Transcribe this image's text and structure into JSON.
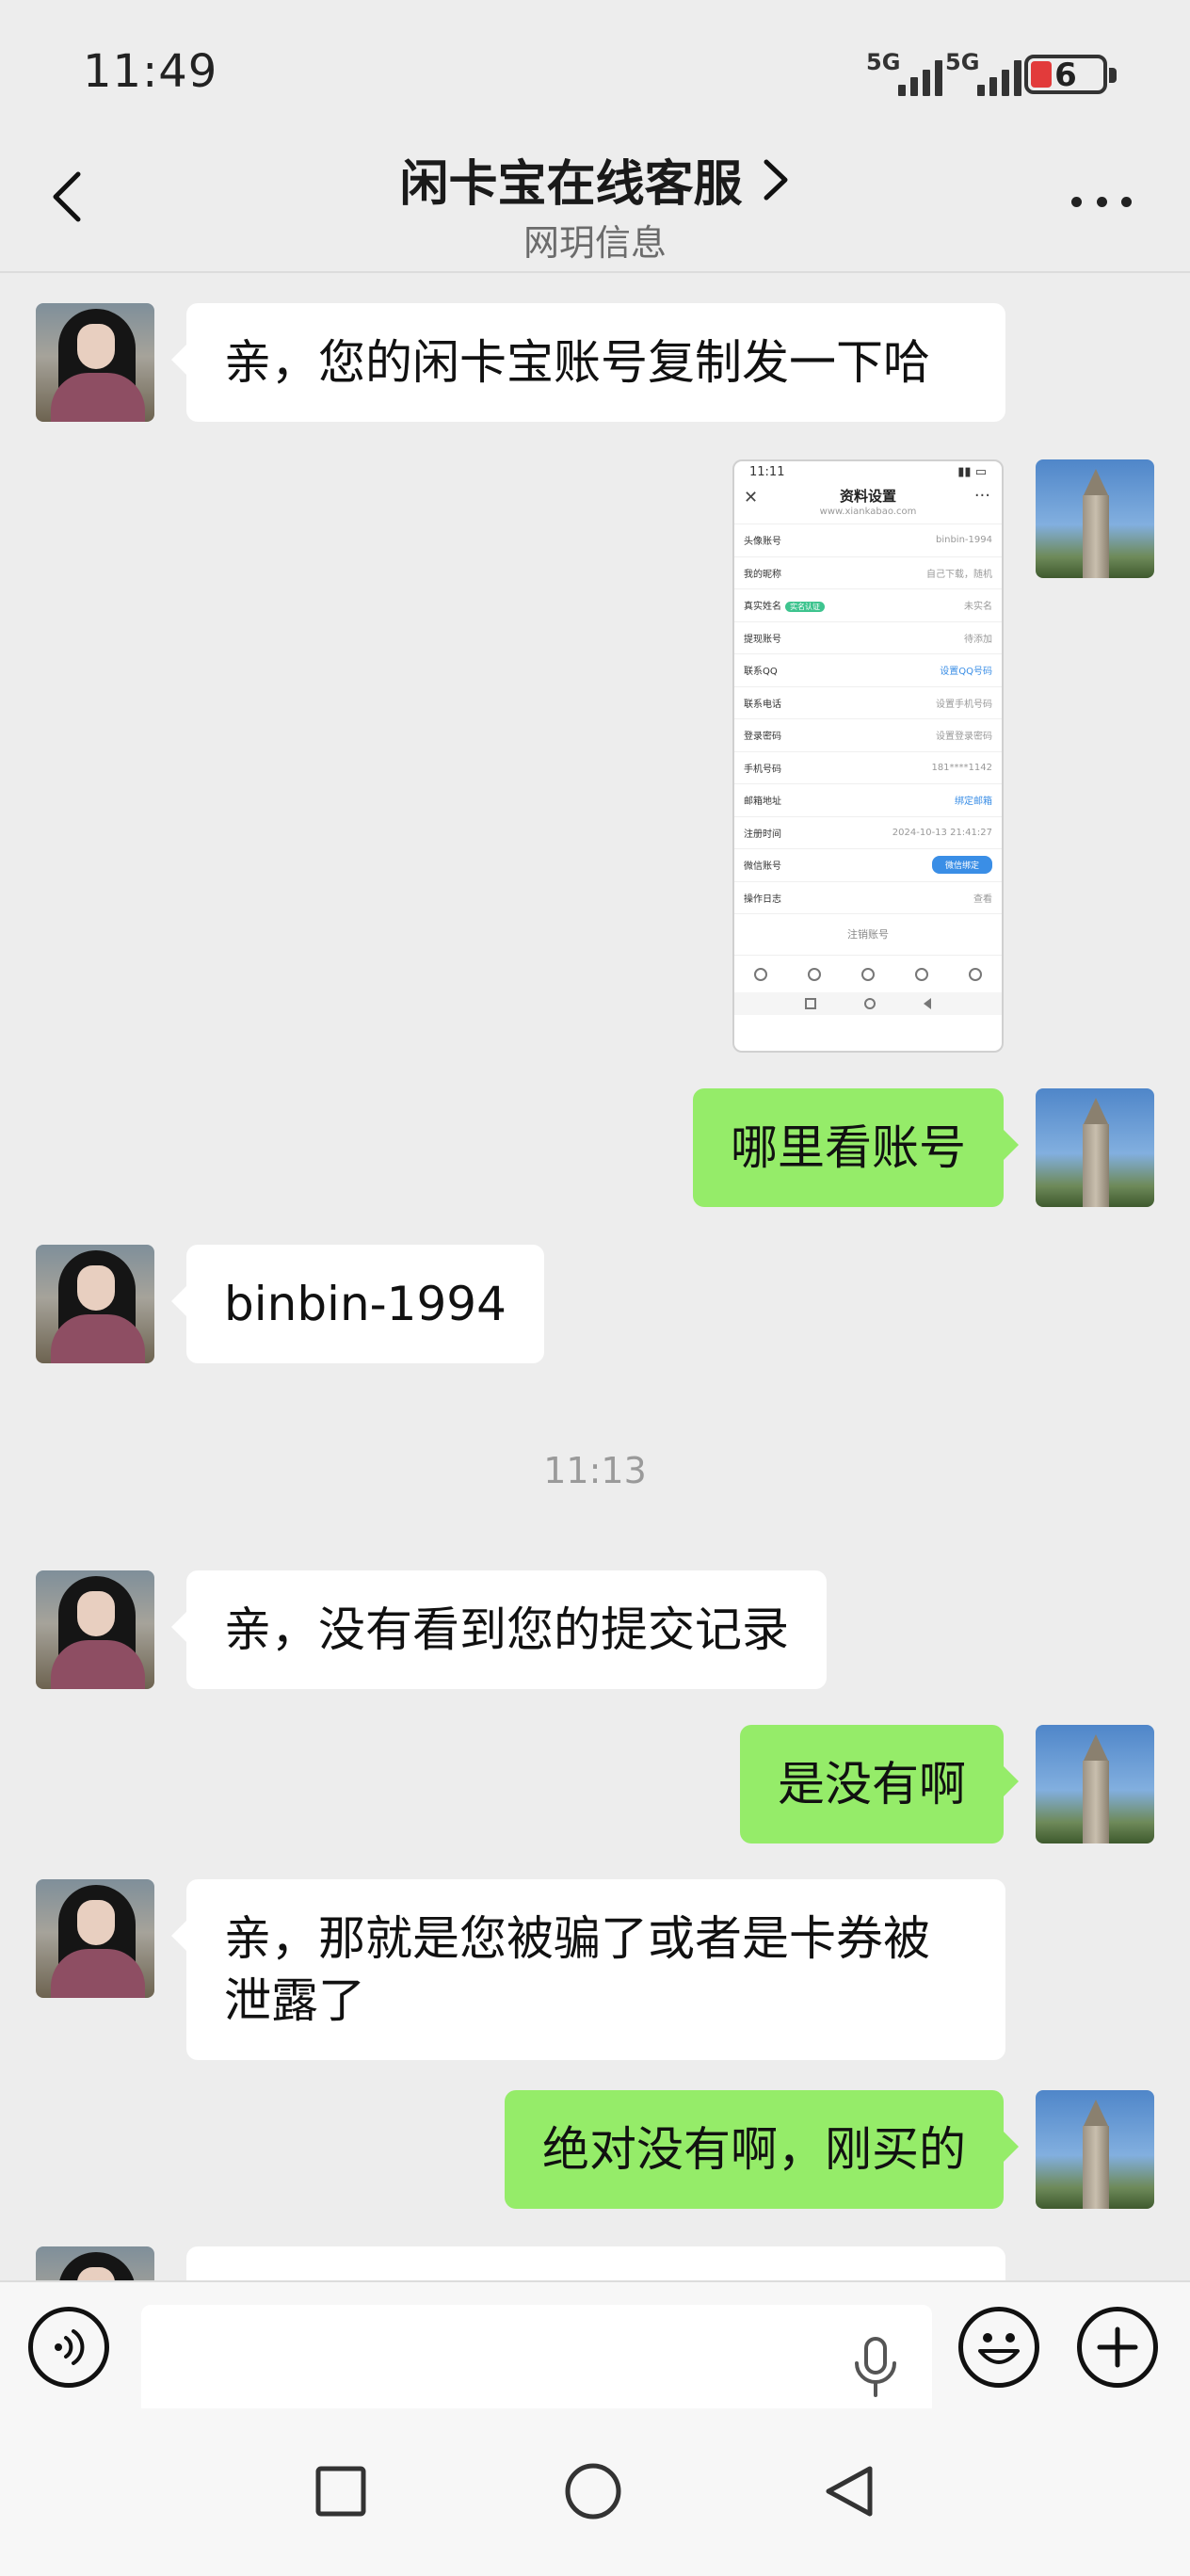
{
  "status_bar": {
    "time": "11:49",
    "signal_1_label": "5G",
    "signal_2_label": "5G",
    "battery_level": "6",
    "battery_color": "#e23b3b"
  },
  "header": {
    "title": "闲卡宝在线客服",
    "subtitle": "网玥信息",
    "back_icon": "chevron-left-icon",
    "more_icon": "more-dots-icon"
  },
  "messages": [
    {
      "from": "agent",
      "type": "text",
      "text": "亲，您的闲卡宝账号复制发一下哈"
    },
    {
      "from": "user",
      "type": "image",
      "image": {
        "status_time": "11:11",
        "title": "资料设置",
        "subtitle": "www.xiankabao.com",
        "rows": [
          {
            "label": "头像账号",
            "value": "binbin-1994"
          },
          {
            "label": "我的昵称",
            "value": "自己下载，随机"
          },
          {
            "label": "真实姓名",
            "value": "未实名",
            "tag": "实名认证"
          },
          {
            "label": "提现账号",
            "value": "待添加"
          },
          {
            "label": "联系QQ",
            "value": "设置QQ号码"
          },
          {
            "label": "联系电话",
            "value": "设置手机号码"
          },
          {
            "label": "登录密码",
            "value": "设置登录密码"
          },
          {
            "label": "手机号码",
            "value": "181****1142"
          },
          {
            "label": "邮箱地址",
            "value": "绑定邮箱"
          },
          {
            "label": "注册时间",
            "value": "2024-10-13 21:41:27"
          },
          {
            "label": "微信账号",
            "value": "",
            "button": "微信绑定"
          },
          {
            "label": "操作日志",
            "value": "查看"
          }
        ],
        "logout": "注销账号"
      }
    },
    {
      "from": "user",
      "type": "text",
      "text": "哪里看账号"
    },
    {
      "from": "agent",
      "type": "text",
      "text": "binbin-1994"
    },
    {
      "type": "timestamp",
      "text": "11:13"
    },
    {
      "from": "agent",
      "type": "text",
      "text": "亲，没有看到您的提交记录"
    },
    {
      "from": "user",
      "type": "text",
      "text": "是没有啊"
    },
    {
      "from": "agent",
      "type": "text",
      "text": "亲，那就是您被骗了或者是卡券被泄露了"
    },
    {
      "from": "user",
      "type": "text",
      "text": "绝对没有啊，刚买的"
    }
  ],
  "input_bar": {
    "voice_icon": "voice-mode-icon",
    "placeholder": "",
    "mic_icon": "microphone-icon",
    "emoji_icon": "emoji-icon",
    "plus_icon": "plus-icon"
  },
  "nav_bar": {
    "recent_icon": "square-recents-icon",
    "home_icon": "circle-home-icon",
    "back_icon": "triangle-back-icon"
  },
  "colors": {
    "background": "#ededed",
    "outgoing_bubble": "#95ec69",
    "incoming_bubble": "#ffffff"
  }
}
